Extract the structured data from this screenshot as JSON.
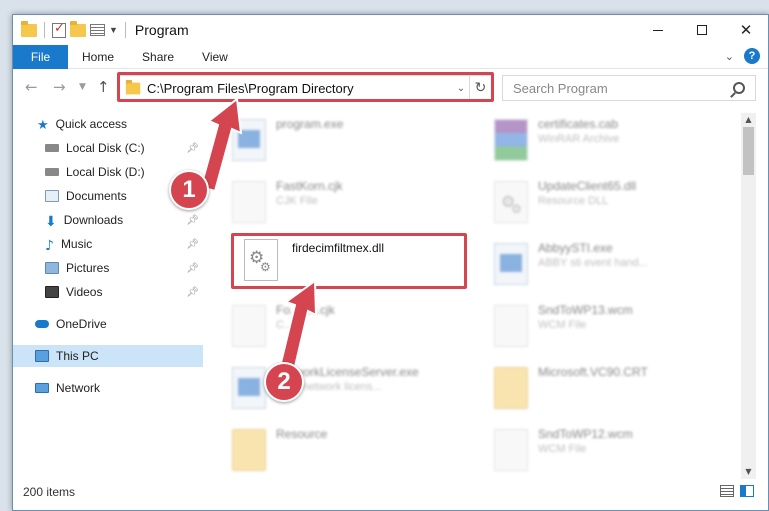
{
  "window": {
    "title": "Program",
    "controls": [
      "minimize",
      "maximize",
      "close"
    ]
  },
  "ribbon": {
    "tabs": [
      "File",
      "Home",
      "Share",
      "View"
    ],
    "help_label": "?"
  },
  "address": {
    "path": "C:\\Program Files\\Program Directory",
    "search_placeholder": "Search Program"
  },
  "sidebar": {
    "items": [
      {
        "label": "Quick access",
        "icon": "star-icon",
        "pinned": false
      },
      {
        "label": "Local Disk (C:)",
        "icon": "drive-icon",
        "pinned": true
      },
      {
        "label": "Local Disk (D:)",
        "icon": "drive-icon",
        "pinned": false
      },
      {
        "label": "Documents",
        "icon": "documents-icon",
        "pinned": true
      },
      {
        "label": "Downloads",
        "icon": "download-icon",
        "pinned": true
      },
      {
        "label": "Music",
        "icon": "music-icon",
        "pinned": true
      },
      {
        "label": "Pictures",
        "icon": "pictures-icon",
        "pinned": true
      },
      {
        "label": "Videos",
        "icon": "videos-icon",
        "pinned": true
      },
      {
        "label": "OneDrive",
        "icon": "cloud-icon",
        "pinned": false
      },
      {
        "label": "This PC",
        "icon": "computer-icon",
        "pinned": false,
        "selected": true
      },
      {
        "label": "Network",
        "icon": "network-icon",
        "pinned": false
      }
    ]
  },
  "files": [
    {
      "name": "program.exe",
      "type": "",
      "icon": "exe-icon"
    },
    {
      "name": "certificates.cab",
      "type": "WinRAR Archive",
      "icon": "cab-icon"
    },
    {
      "name": "FastKorn.cjk",
      "type": "CJK File",
      "icon": "file-icon"
    },
    {
      "name": "UpdateClient65.dll",
      "type": "Resource DLL",
      "icon": "dll-icon"
    },
    {
      "name": "firdecimfiltmex.dll",
      "type": "",
      "icon": "dll-icon",
      "highlighted": true
    },
    {
      "name": "AbbyySTI.exe",
      "type": "ABBY sti event hand...",
      "icon": "exe-icon"
    },
    {
      "name": "Fo...ent.cjk",
      "type": "C...ile",
      "icon": "file-icon"
    },
    {
      "name": "SndToWP13.wcm",
      "type": "WCM File",
      "icon": "file-icon"
    },
    {
      "name": "NetworkLicenseServer.exe",
      "type": "...BY network licens...",
      "icon": "exe-icon"
    },
    {
      "name": "Microsoft.VC90.CRT",
      "type": "",
      "icon": "folder-icon"
    },
    {
      "name": "Resource",
      "type": "",
      "icon": "folder-icon"
    },
    {
      "name": "SndToWP12.wcm",
      "type": "WCM File",
      "icon": "file-icon"
    }
  ],
  "status": {
    "item_count": "200 items"
  },
  "callouts": [
    "1",
    "2"
  ],
  "colors": {
    "accent": "#1979ca",
    "highlight": "#d5454f",
    "selection": "#cce4f7"
  }
}
